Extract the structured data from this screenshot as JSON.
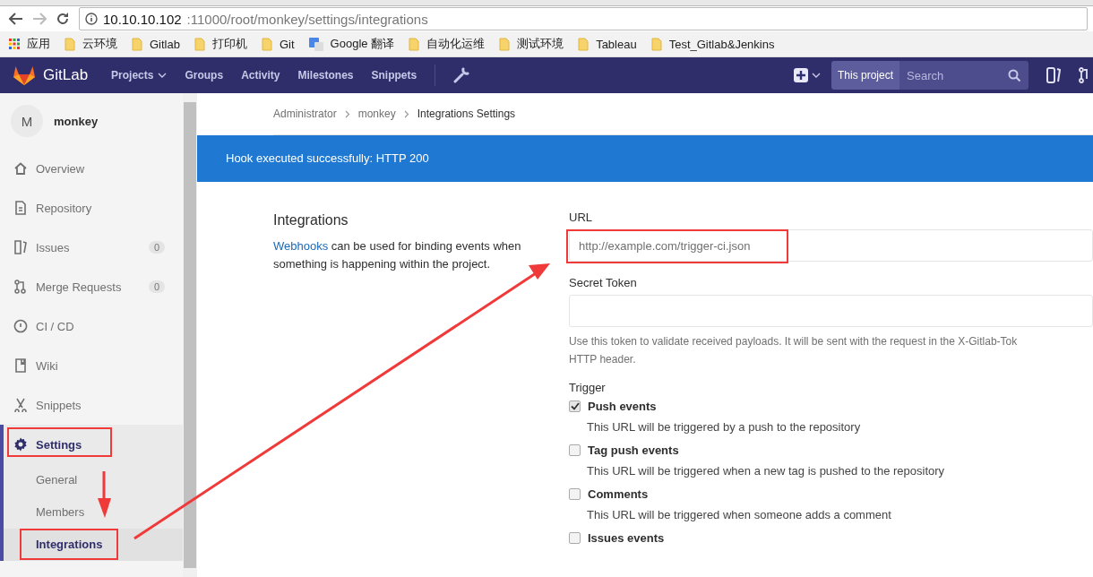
{
  "browser": {
    "address_host": "10.10.10.102",
    "address_path": ":11000/root/monkey/settings/integrations",
    "bookmarks": [
      {
        "label": "应用",
        "kind": "apps"
      },
      {
        "label": "云环境",
        "kind": "folder"
      },
      {
        "label": "Gitlab",
        "kind": "folder"
      },
      {
        "label": "打印机",
        "kind": "folder"
      },
      {
        "label": "Git",
        "kind": "folder"
      },
      {
        "label": "Google 翻译",
        "kind": "translate"
      },
      {
        "label": "自动化运维",
        "kind": "folder"
      },
      {
        "label": "测试环境",
        "kind": "folder"
      },
      {
        "label": "Tableau",
        "kind": "folder"
      },
      {
        "label": "Test_Gitlab&Jenkins",
        "kind": "folder"
      }
    ]
  },
  "navbar": {
    "brand": "GitLab",
    "items": [
      {
        "label": "Projects",
        "dropdown": true
      },
      {
        "label": "Groups",
        "dropdown": false
      },
      {
        "label": "Activity",
        "dropdown": false
      },
      {
        "label": "Milestones",
        "dropdown": false
      },
      {
        "label": "Snippets",
        "dropdown": false
      }
    ],
    "scope": "This project",
    "search_placeholder": "Search"
  },
  "sidebar": {
    "avatar_letter": "M",
    "project": "monkey",
    "items": [
      {
        "label": "Overview",
        "selected": false
      },
      {
        "label": "Repository",
        "selected": false
      },
      {
        "label": "Issues",
        "count": "0",
        "selected": false
      },
      {
        "label": "Merge Requests",
        "count": "0",
        "selected": false
      },
      {
        "label": "CI / CD",
        "selected": false
      },
      {
        "label": "Wiki",
        "selected": false
      },
      {
        "label": "Snippets",
        "selected": false
      },
      {
        "label": "Settings",
        "selected": true,
        "children": [
          {
            "label": "General",
            "selected": false
          },
          {
            "label": "Members",
            "selected": false
          },
          {
            "label": "Integrations",
            "selected": true
          }
        ]
      }
    ]
  },
  "breadcrumb": [
    {
      "label": "Administrator",
      "current": false
    },
    {
      "label": "monkey",
      "current": false
    },
    {
      "label": "Integrations Settings",
      "current": true
    }
  ],
  "flash": "Hook executed successfully: HTTP 200",
  "intro": {
    "title": "Integrations",
    "link": "Webhooks",
    "text": " can be used for binding events when something is happening within the project."
  },
  "form": {
    "url_label": "URL",
    "url_placeholder": "http://example.com/trigger-ci.json",
    "token_label": "Secret Token",
    "token_help": [
      "Use this token to validate received payloads. It will be sent with the request in the X-Gitlab-Tok",
      "HTTP header."
    ],
    "trigger_label": "Trigger",
    "triggers": [
      {
        "label": "Push events",
        "checked": true,
        "help": "This URL will be triggered by a push to the repository"
      },
      {
        "label": "Tag push events",
        "checked": false,
        "help": "This URL will be triggered when a new tag is pushed to the repository"
      },
      {
        "label": "Comments",
        "checked": false,
        "help": "This URL will be triggered when someone adds a comment"
      },
      {
        "label": "Issues events",
        "checked": false
      }
    ]
  }
}
